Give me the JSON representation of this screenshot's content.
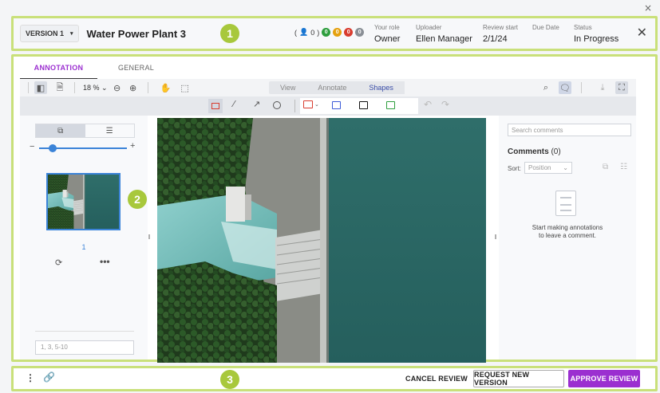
{
  "window": {
    "close_glyph": "×"
  },
  "header": {
    "version_label": "VERSION 1",
    "title": "Water Power Plant 3",
    "collaborators": {
      "count_text": "0",
      "dots": [
        {
          "value": "0",
          "color": "#2e9e3e"
        },
        {
          "value": "0",
          "color": "#e5a10f"
        },
        {
          "value": "0",
          "color": "#d83c2f"
        },
        {
          "value": "0",
          "color": "#8a8f96"
        }
      ]
    },
    "meta": [
      {
        "label": "Your role",
        "value": "Owner"
      },
      {
        "label": "Uploader",
        "value": "Ellen Manager"
      },
      {
        "label": "Review start",
        "value": "2/1/24"
      },
      {
        "label": "Due Date",
        "value": ""
      },
      {
        "label": "Status",
        "value": "In Progress"
      }
    ],
    "close_glyph": "✕"
  },
  "badges": {
    "one": "1",
    "two": "2",
    "three": "3"
  },
  "tabs": [
    {
      "label": "ANNOTATION",
      "active": true
    },
    {
      "label": "GENERAL",
      "active": false
    }
  ],
  "toolbar": {
    "zoom": "18 %",
    "modes": [
      {
        "label": "View"
      },
      {
        "label": "Annotate"
      },
      {
        "label": "Shapes",
        "active": true
      }
    ]
  },
  "shapes_bar": {
    "colors": [
      "#d83c2f",
      "#3b5bd8",
      "#111111",
      "#2e9e3e"
    ]
  },
  "thumbs": {
    "zoom_level": 0.15,
    "page_number": "1",
    "page_range_placeholder": "1, 3, 5-10"
  },
  "comments": {
    "search_placeholder": "Search comments",
    "title": "Comments",
    "count": "(0)",
    "sort_label": "Sort:",
    "sort_value": "Position",
    "empty_text_1": "Start making annotations",
    "empty_text_2": "to leave a comment."
  },
  "footer": {
    "cancel": "CANCEL REVIEW",
    "request": "REQUEST NEW VERSION",
    "approve": "APPROVE REVIEW"
  },
  "colors": {
    "accent": "#9b2fd0",
    "highlight_frame": "#c9e07a",
    "badge": "#a8c83c"
  }
}
